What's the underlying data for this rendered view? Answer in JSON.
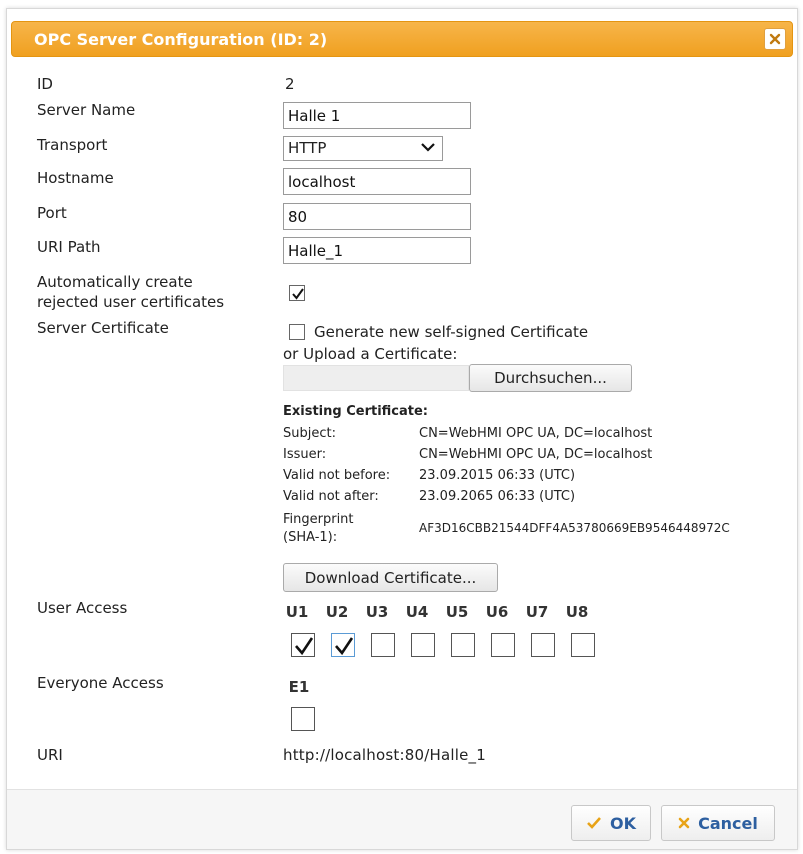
{
  "dialog": {
    "title": "OPC Server Configuration (ID: 2)",
    "close_icon": "close-icon"
  },
  "form": {
    "id_label": "ID",
    "id_value": "2",
    "server_name_label": "Server Name",
    "server_name_value": "Halle 1",
    "transport_label": "Transport",
    "transport_value": "HTTP",
    "hostname_label": "Hostname",
    "hostname_value": "localhost",
    "port_label": "Port",
    "port_value": "80",
    "uri_path_label": "URI Path",
    "uri_path_value": "Halle_1",
    "auto_create_label_line1": "Automatically create",
    "auto_create_label_line2": "rejected user certificates",
    "auto_create_checked": true,
    "server_cert_label": "Server Certificate",
    "generate_cert_label": "Generate new self-signed Certificate",
    "generate_cert_checked": false,
    "upload_label": "or Upload a Certificate:",
    "browse_label": "Durchsuchen..."
  },
  "certificate": {
    "heading": "Existing Certificate:",
    "subject_label": "Subject:",
    "subject_value": "CN=WebHMI OPC UA, DC=localhost",
    "issuer_label": "Issuer:",
    "issuer_value": "CN=WebHMI OPC UA, DC=localhost",
    "valid_before_label": "Valid not before:",
    "valid_before_value": "23.09.2015 06:33 (UTC)",
    "valid_after_label": "Valid not after:",
    "valid_after_value": "23.09.2065 06:33 (UTC)",
    "fingerprint_label_line1": "Fingerprint",
    "fingerprint_label_line2": "(SHA-1):",
    "fingerprint_value": "AF3D16CBB21544DFF4A53780669EB9546448972C",
    "download_label": "Download Certificate..."
  },
  "user_access": {
    "label": "User Access",
    "users": [
      {
        "label": "U1",
        "checked": true
      },
      {
        "label": "U2",
        "checked": true
      },
      {
        "label": "U3",
        "checked": false
      },
      {
        "label": "U4",
        "checked": false
      },
      {
        "label": "U5",
        "checked": false
      },
      {
        "label": "U6",
        "checked": false
      },
      {
        "label": "U7",
        "checked": false
      },
      {
        "label": "U8",
        "checked": false
      }
    ]
  },
  "everyone_access": {
    "label": "Everyone Access",
    "e1_label": "E1",
    "e1_checked": false
  },
  "uri": {
    "label": "URI",
    "value": "http://localhost:80/Halle_1"
  },
  "footer": {
    "ok_label": "OK",
    "cancel_label": "Cancel",
    "ok_icon": "check-icon",
    "cancel_icon": "x-icon",
    "ok_color": "#e8a317",
    "cancel_color": "#e8a317"
  },
  "colors": {
    "titlebar": "#f0a020",
    "button_text": "#2d5fa0"
  }
}
